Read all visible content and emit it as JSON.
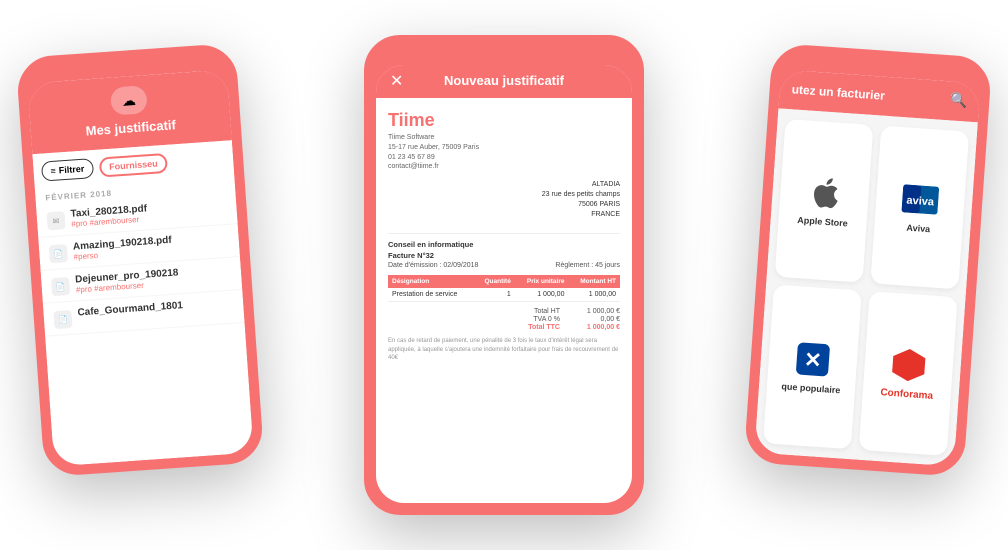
{
  "left_phone": {
    "header_title": "Mes justificatif",
    "cloud_icon": "☁",
    "filter_label": "Filtrer",
    "supplier_label": "Fournisseu",
    "month_label": "FÉVRIER 2018",
    "documents": [
      {
        "title": "Taxi_280218.pdf",
        "tags": "#pro #arembourser",
        "has_icon": true
      },
      {
        "title": "Amazing_190218.pdf",
        "tags": "#perso",
        "has_icon": false
      },
      {
        "title": "Dejeuner_pro_190218",
        "tags": "#pro #arembourser",
        "has_icon": false
      },
      {
        "title": "Cafe_Gourmand_1801",
        "tags": "",
        "has_icon": false
      }
    ]
  },
  "center_phone": {
    "header_title": "Nouveau justificatif",
    "close_icon": "✕",
    "company_name": "Tiime",
    "company_info_line1": "Tiime Software",
    "company_info_line2": "15-17 rue Auber, 75009 Paris",
    "company_info_line3": "01 23 45 67 89",
    "company_info_line4": "contact@tiime.fr",
    "to_name": "ALTADIA",
    "to_address1": "23 rue des petits champs",
    "to_zip": "75006  PARIS",
    "to_country": "FRANCE",
    "category": "Conseil en informatique",
    "invoice_ref": "Facture N°32",
    "date_label": "Date d'émission : 02/09/2018",
    "payment_label": "Règlement : 45 jours",
    "table_headers": [
      "Désignation",
      "Quantité",
      "Prix unitaire",
      "Montant HT"
    ],
    "table_rows": [
      [
        "Prestation de service",
        "1",
        "1 000,00",
        "1 000,00"
      ]
    ],
    "total_ht_label": "Total HT",
    "total_ht_value": "1 000,00 €",
    "tva_label": "TVA 0 %",
    "tva_value": "0,00 €",
    "total_ttc_label": "Total TTC",
    "total_ttc_value": "1 000,00 €",
    "footer_text": "En cas de retard de paiement, une pénalité de 3 fois le taux d'intérêt légal sera appliquée, à laquelle s'ajoutera une indemnité forfaitaire pour frais de recouvrement de 40€"
  },
  "right_phone": {
    "header_title": "utez un facturier",
    "search_icon": "🔍",
    "vendors": [
      {
        "name": "Apple Store",
        "logo_type": "apple"
      },
      {
        "name": "Aviva",
        "logo_type": "aviva"
      },
      {
        "name": "que populaire",
        "logo_type": "banque"
      },
      {
        "name": "Conforama",
        "logo_type": "conforama"
      }
    ]
  }
}
